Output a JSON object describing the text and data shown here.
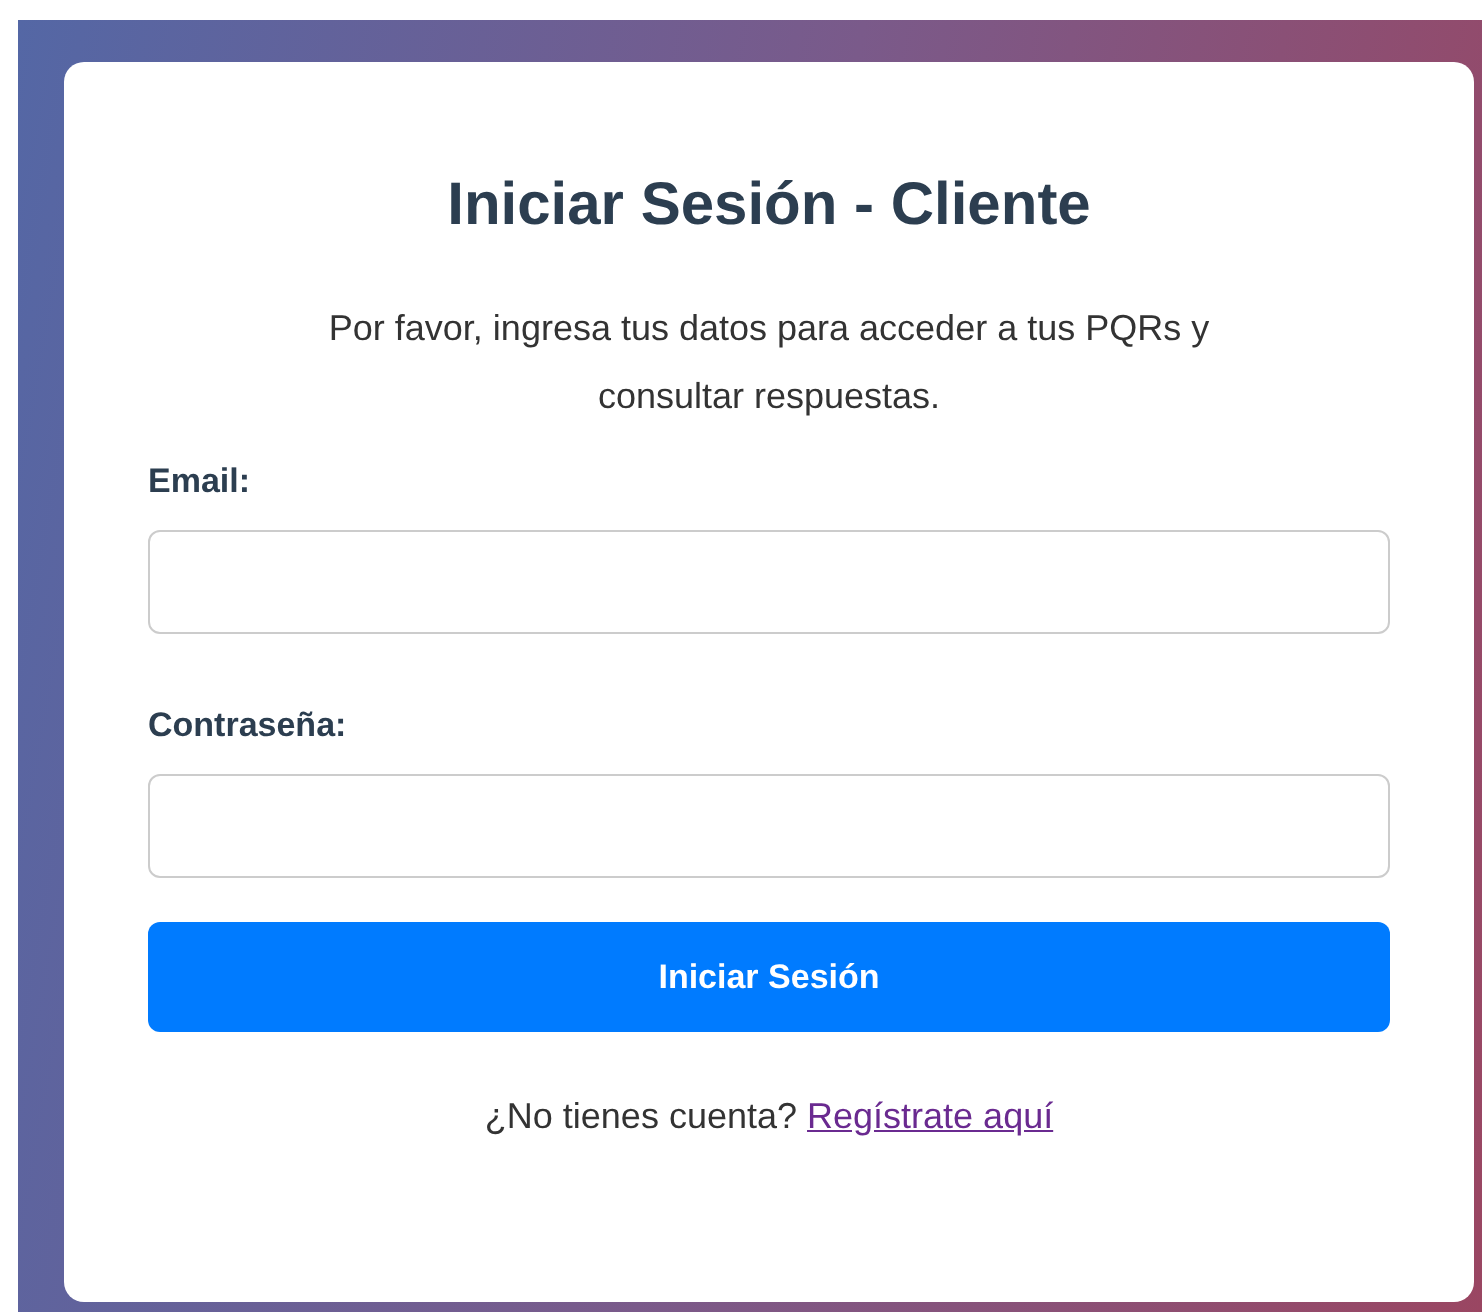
{
  "title": "Iniciar Sesión - Cliente",
  "intro": "Por favor, ingresa tus datos para acceder a tus PQRs y consultar respuestas.",
  "fields": [
    {
      "label": "Email:"
    },
    {
      "label": "Contraseña:"
    }
  ],
  "submit_button": "Iniciar Sesión",
  "footer": {
    "text": "¿No tienes cuenta?",
    "link": "Regístrate aquí"
  }
}
